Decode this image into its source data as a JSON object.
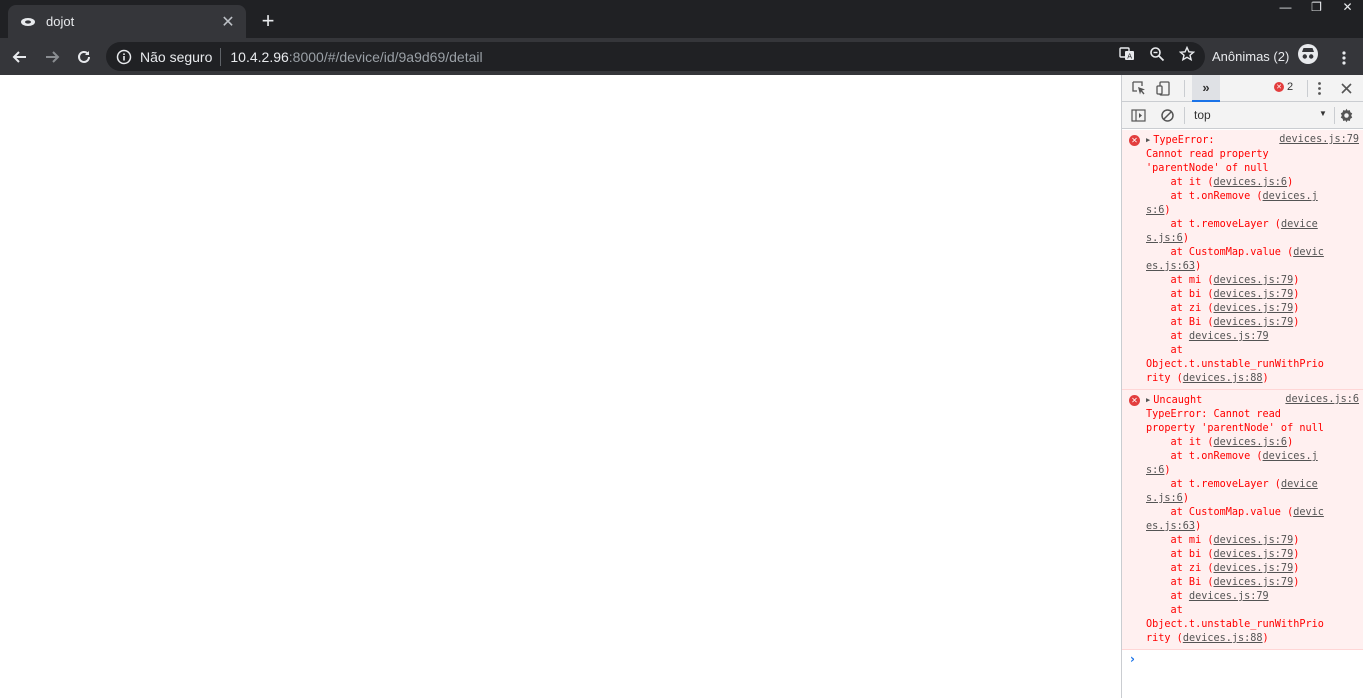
{
  "browser": {
    "tab": {
      "title": "dojot",
      "close_glyph": "✕"
    },
    "new_tab_glyph": "+",
    "window_controls": [
      "—",
      "❐",
      "✕"
    ],
    "address": {
      "security_label": "Não seguro",
      "host": "10.4.2.96",
      "rest": ":8000/#/device/id/9a9d69/detail"
    },
    "profile_label": "Anônimas (2)"
  },
  "devtools": {
    "more_tabs_glyph": "»",
    "error_count": "2",
    "context": "top",
    "messages": [
      {
        "head_text": "TypeError:",
        "source": "devices.js:79",
        "lines": [
          "Cannot read property",
          "'parentNode' of null",
          [
            {
              "t": "    at it ("
            },
            {
              "l": "devices.js:6"
            },
            {
              "t": ")"
            }
          ],
          [
            {
              "t": "    at t.onRemove ("
            },
            {
              "l": "devices.j"
            }
          ],
          [
            {
              "l": "s:6"
            },
            {
              "t": ")"
            }
          ],
          [
            {
              "t": "    at t.removeLayer ("
            },
            {
              "l": "device"
            }
          ],
          [
            {
              "l": "s.js:6"
            },
            {
              "t": ")"
            }
          ],
          [
            {
              "t": "    at CustomMap.value ("
            },
            {
              "l": "devic"
            }
          ],
          [
            {
              "l": "es.js:63"
            },
            {
              "t": ")"
            }
          ],
          [
            {
              "t": "    at mi ("
            },
            {
              "l": "devices.js:79"
            },
            {
              "t": ")"
            }
          ],
          [
            {
              "t": "    at bi ("
            },
            {
              "l": "devices.js:79"
            },
            {
              "t": ")"
            }
          ],
          [
            {
              "t": "    at zi ("
            },
            {
              "l": "devices.js:79"
            },
            {
              "t": ")"
            }
          ],
          [
            {
              "t": "    at Bi ("
            },
            {
              "l": "devices.js:79"
            },
            {
              "t": ")"
            }
          ],
          [
            {
              "t": "    at "
            },
            {
              "l": "devices.js:79"
            }
          ],
          "    at",
          "Object.t.unstable_runWithPrio",
          [
            {
              "t": "rity ("
            },
            {
              "l": "devices.js:88"
            },
            {
              "t": ")"
            }
          ]
        ]
      },
      {
        "head_text": "Uncaught",
        "source": "devices.js:6",
        "lines": [
          "TypeError: Cannot read",
          "property 'parentNode' of null",
          [
            {
              "t": "    at it ("
            },
            {
              "l": "devices.js:6"
            },
            {
              "t": ")"
            }
          ],
          [
            {
              "t": "    at t.onRemove ("
            },
            {
              "l": "devices.j"
            }
          ],
          [
            {
              "l": "s:6"
            },
            {
              "t": ")"
            }
          ],
          [
            {
              "t": "    at t.removeLayer ("
            },
            {
              "l": "device"
            }
          ],
          [
            {
              "l": "s.js:6"
            },
            {
              "t": ")"
            }
          ],
          [
            {
              "t": "    at CustomMap.value ("
            },
            {
              "l": "devic"
            }
          ],
          [
            {
              "l": "es.js:63"
            },
            {
              "t": ")"
            }
          ],
          [
            {
              "t": "    at mi ("
            },
            {
              "l": "devices.js:79"
            },
            {
              "t": ")"
            }
          ],
          [
            {
              "t": "    at bi ("
            },
            {
              "l": "devices.js:79"
            },
            {
              "t": ")"
            }
          ],
          [
            {
              "t": "    at zi ("
            },
            {
              "l": "devices.js:79"
            },
            {
              "t": ")"
            }
          ],
          [
            {
              "t": "    at Bi ("
            },
            {
              "l": "devices.js:79"
            },
            {
              "t": ")"
            }
          ],
          [
            {
              "t": "    at "
            },
            {
              "l": "devices.js:79"
            }
          ],
          "    at",
          "Object.t.unstable_runWithPrio",
          [
            {
              "t": "rity ("
            },
            {
              "l": "devices.js:88"
            },
            {
              "t": ")"
            }
          ]
        ]
      }
    ],
    "prompt_glyph": "›"
  },
  "colors": {
    "chrome_dark": "#202124",
    "toolbar": "#35363a",
    "error_text": "#ff0000",
    "error_bg": "#fff0f0",
    "accent": "#1a73e8"
  }
}
